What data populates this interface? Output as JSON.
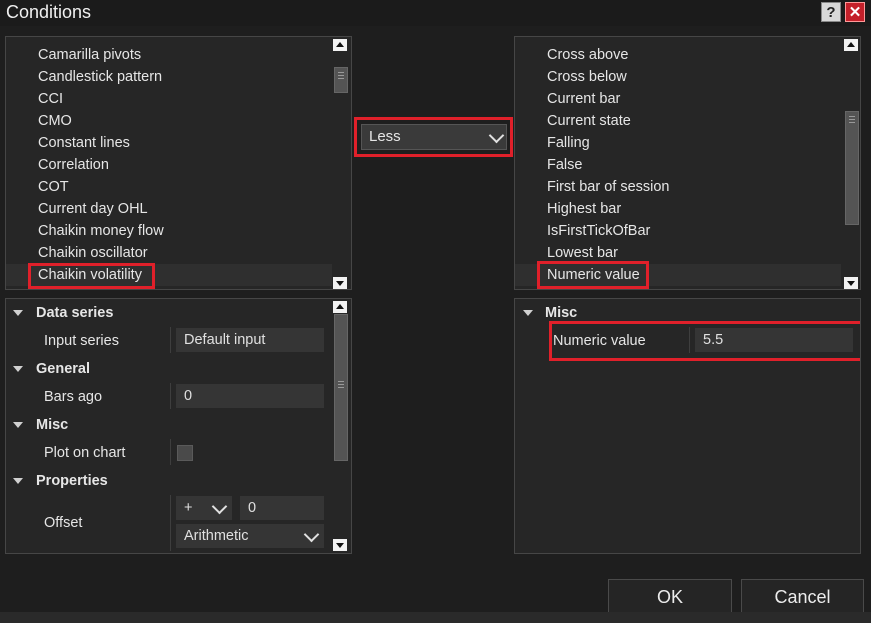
{
  "window": {
    "title": "Conditions",
    "help_label": "?",
    "close_label": "✕"
  },
  "left_list": {
    "items": [
      "Camarilla pivots",
      "Candlestick pattern",
      "CCI",
      "CMO",
      "Constant lines",
      "Correlation",
      "COT",
      "Current day OHL",
      "Chaikin money flow",
      "Chaikin oscillator",
      "Chaikin volatility"
    ],
    "selected": "Chaikin volatility"
  },
  "operator": {
    "value": "Less"
  },
  "right_list": {
    "items": [
      "Cross above",
      "Cross below",
      "Current bar",
      "Current state",
      "Falling",
      "False",
      "First bar of session",
      "Highest bar",
      "IsFirstTickOfBar",
      "Lowest bar",
      "Numeric value"
    ],
    "selected": "Numeric value"
  },
  "left_props": {
    "data_series": {
      "title": "Data series",
      "input_series_label": "Input series",
      "input_series_value": "Default input"
    },
    "general": {
      "title": "General",
      "bars_ago_label": "Bars ago",
      "bars_ago_value": "0"
    },
    "misc": {
      "title": "Misc",
      "plot_on_chart_label": "Plot on chart",
      "plot_on_chart_checked": false
    },
    "properties": {
      "title": "Properties",
      "offset_label": "Offset",
      "offset_sign": "+",
      "offset_value": "0",
      "offset_type": "Arithmetic"
    }
  },
  "right_props": {
    "misc": {
      "title": "Misc",
      "numeric_value_label": "Numeric value",
      "numeric_value": "5.5"
    }
  },
  "buttons": {
    "ok_label": "OK",
    "cancel_label": "Cancel"
  },
  "colors": {
    "highlight": "#e0202a",
    "background": "#1e1e1e",
    "panel": "#262626"
  }
}
